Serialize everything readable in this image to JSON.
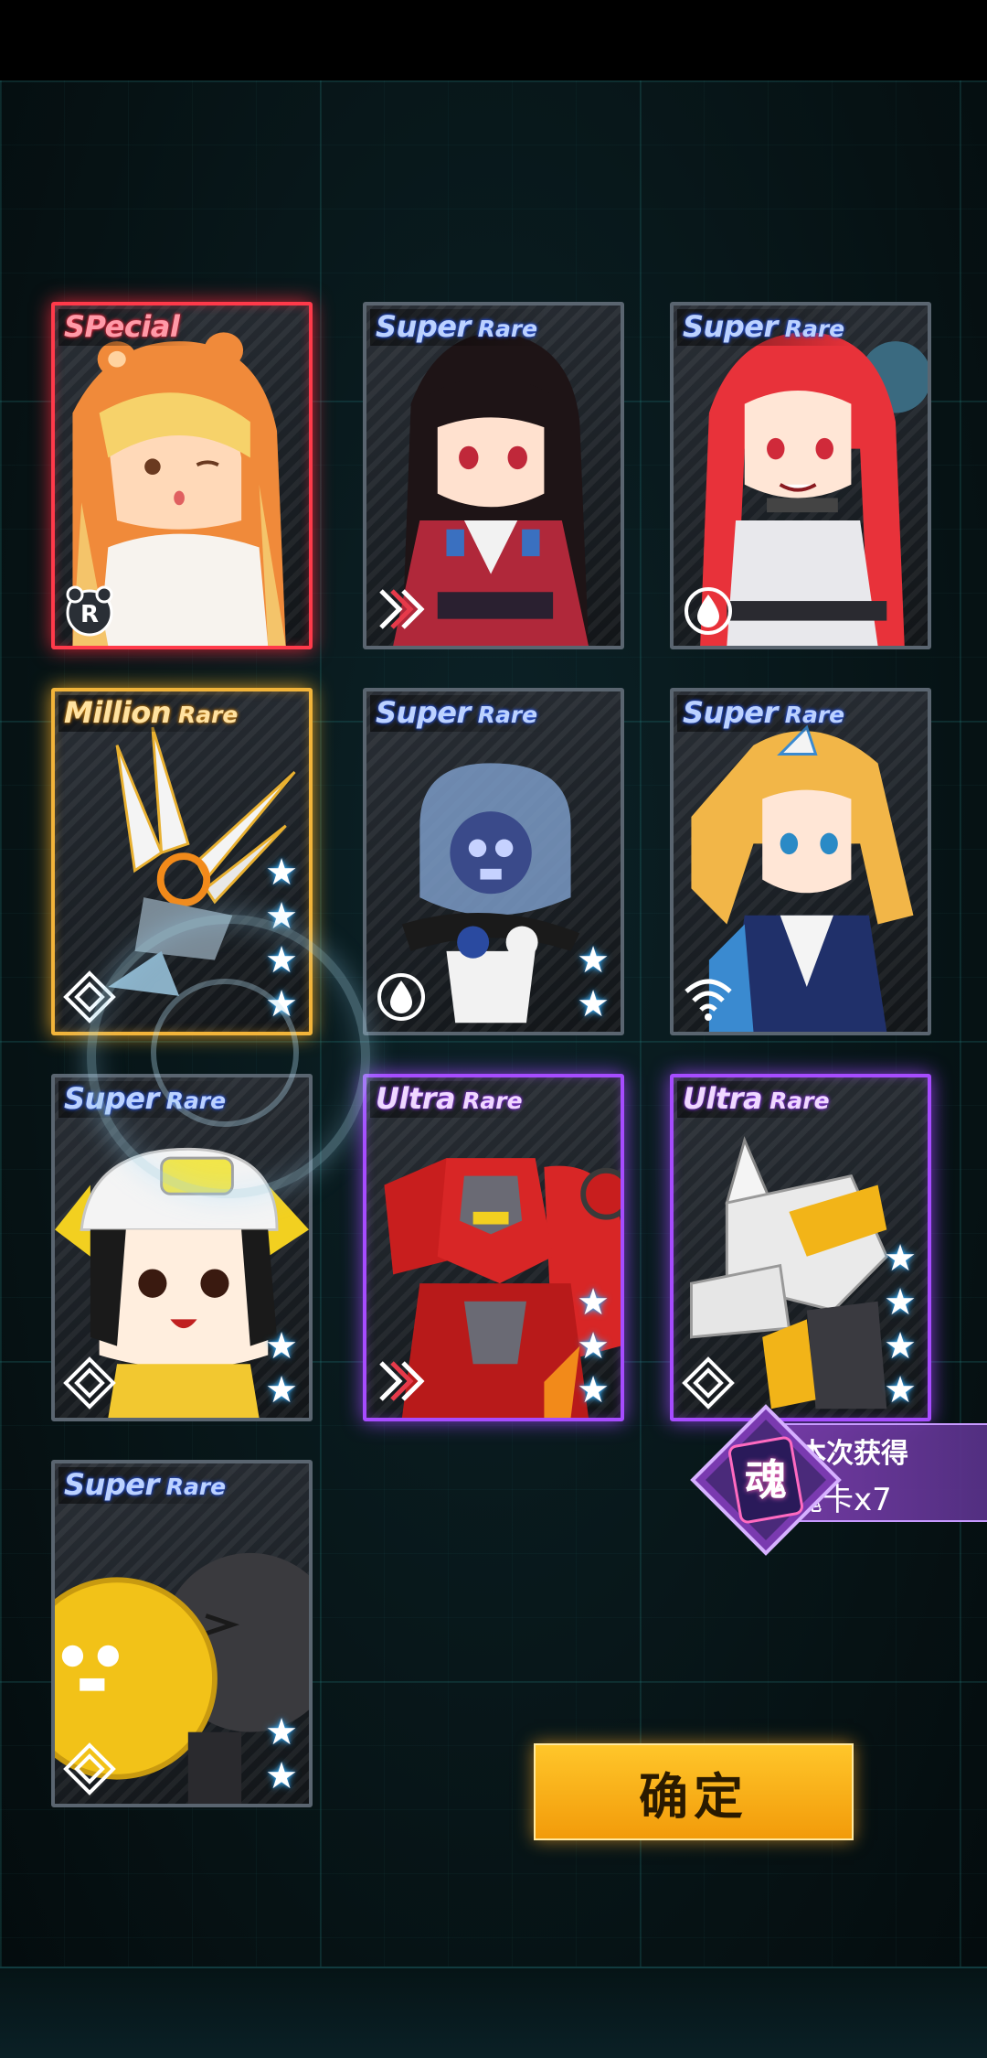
{
  "cards": [
    {
      "rarity_main": "SPecial",
      "rarity_sub": "",
      "stars": 0,
      "element": "r-badge-icon"
    },
    {
      "rarity_main": "Super",
      "rarity_sub": "Rare",
      "stars": 0,
      "element": "stripes-icon"
    },
    {
      "rarity_main": "Super",
      "rarity_sub": "Rare",
      "stars": 0,
      "element": "water-icon"
    },
    {
      "rarity_main": "Million",
      "rarity_sub": "Rare",
      "stars": 4,
      "element": "diamond-icon"
    },
    {
      "rarity_main": "Super",
      "rarity_sub": "Rare",
      "stars": 2,
      "element": "water-icon"
    },
    {
      "rarity_main": "Super",
      "rarity_sub": "Rare",
      "stars": 0,
      "element": "wifi-icon"
    },
    {
      "rarity_main": "Super",
      "rarity_sub": "Rare",
      "stars": 2,
      "element": "diamond-icon"
    },
    {
      "rarity_main": "Ultra",
      "rarity_sub": "Rare",
      "stars": 3,
      "element": "stripes-icon"
    },
    {
      "rarity_main": "Ultra",
      "rarity_sub": "Rare",
      "stars": 4,
      "element": "diamond-icon"
    },
    {
      "rarity_main": "Super",
      "rarity_sub": "Rare",
      "stars": 2,
      "element": "diamond-icon"
    }
  ],
  "soul": {
    "icon_char": "魂",
    "label": "本次获得",
    "count_text": "魂卡x7"
  },
  "confirm_label": "确定",
  "colors": {
    "special": "#ff3a4a",
    "million": "#f2b43a",
    "ultra": "#a64cff",
    "super_text": "#bcd2ff",
    "star_glow": "#3ab8ff",
    "confirm": "#f7ad16"
  }
}
